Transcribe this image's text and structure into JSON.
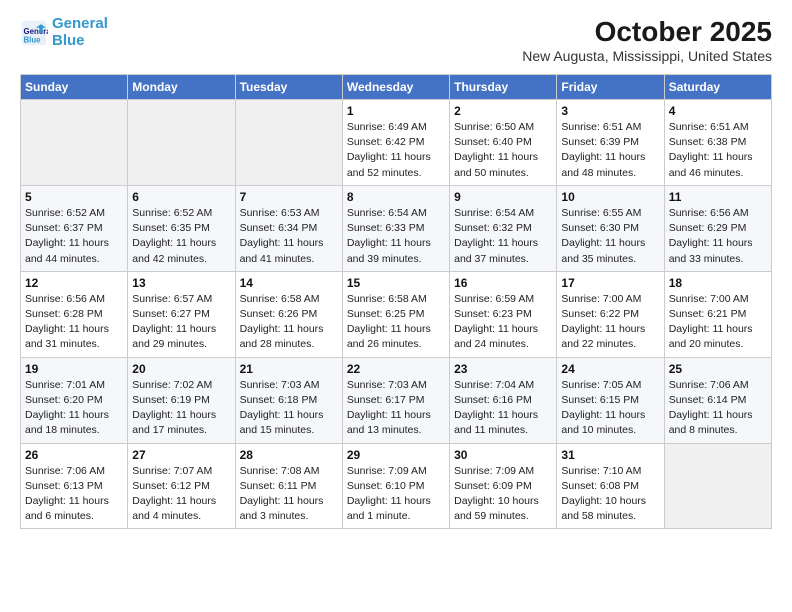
{
  "logo": {
    "line1": "General",
    "line2": "Blue"
  },
  "title": "October 2025",
  "subtitle": "New Augusta, Mississippi, United States",
  "days_header": [
    "Sunday",
    "Monday",
    "Tuesday",
    "Wednesday",
    "Thursday",
    "Friday",
    "Saturday"
  ],
  "weeks": [
    [
      {
        "num": "",
        "info": ""
      },
      {
        "num": "",
        "info": ""
      },
      {
        "num": "",
        "info": ""
      },
      {
        "num": "1",
        "info": "Sunrise: 6:49 AM\nSunset: 6:42 PM\nDaylight: 11 hours\nand 52 minutes."
      },
      {
        "num": "2",
        "info": "Sunrise: 6:50 AM\nSunset: 6:40 PM\nDaylight: 11 hours\nand 50 minutes."
      },
      {
        "num": "3",
        "info": "Sunrise: 6:51 AM\nSunset: 6:39 PM\nDaylight: 11 hours\nand 48 minutes."
      },
      {
        "num": "4",
        "info": "Sunrise: 6:51 AM\nSunset: 6:38 PM\nDaylight: 11 hours\nand 46 minutes."
      }
    ],
    [
      {
        "num": "5",
        "info": "Sunrise: 6:52 AM\nSunset: 6:37 PM\nDaylight: 11 hours\nand 44 minutes."
      },
      {
        "num": "6",
        "info": "Sunrise: 6:52 AM\nSunset: 6:35 PM\nDaylight: 11 hours\nand 42 minutes."
      },
      {
        "num": "7",
        "info": "Sunrise: 6:53 AM\nSunset: 6:34 PM\nDaylight: 11 hours\nand 41 minutes."
      },
      {
        "num": "8",
        "info": "Sunrise: 6:54 AM\nSunset: 6:33 PM\nDaylight: 11 hours\nand 39 minutes."
      },
      {
        "num": "9",
        "info": "Sunrise: 6:54 AM\nSunset: 6:32 PM\nDaylight: 11 hours\nand 37 minutes."
      },
      {
        "num": "10",
        "info": "Sunrise: 6:55 AM\nSunset: 6:30 PM\nDaylight: 11 hours\nand 35 minutes."
      },
      {
        "num": "11",
        "info": "Sunrise: 6:56 AM\nSunset: 6:29 PM\nDaylight: 11 hours\nand 33 minutes."
      }
    ],
    [
      {
        "num": "12",
        "info": "Sunrise: 6:56 AM\nSunset: 6:28 PM\nDaylight: 11 hours\nand 31 minutes."
      },
      {
        "num": "13",
        "info": "Sunrise: 6:57 AM\nSunset: 6:27 PM\nDaylight: 11 hours\nand 29 minutes."
      },
      {
        "num": "14",
        "info": "Sunrise: 6:58 AM\nSunset: 6:26 PM\nDaylight: 11 hours\nand 28 minutes."
      },
      {
        "num": "15",
        "info": "Sunrise: 6:58 AM\nSunset: 6:25 PM\nDaylight: 11 hours\nand 26 minutes."
      },
      {
        "num": "16",
        "info": "Sunrise: 6:59 AM\nSunset: 6:23 PM\nDaylight: 11 hours\nand 24 minutes."
      },
      {
        "num": "17",
        "info": "Sunrise: 7:00 AM\nSunset: 6:22 PM\nDaylight: 11 hours\nand 22 minutes."
      },
      {
        "num": "18",
        "info": "Sunrise: 7:00 AM\nSunset: 6:21 PM\nDaylight: 11 hours\nand 20 minutes."
      }
    ],
    [
      {
        "num": "19",
        "info": "Sunrise: 7:01 AM\nSunset: 6:20 PM\nDaylight: 11 hours\nand 18 minutes."
      },
      {
        "num": "20",
        "info": "Sunrise: 7:02 AM\nSunset: 6:19 PM\nDaylight: 11 hours\nand 17 minutes."
      },
      {
        "num": "21",
        "info": "Sunrise: 7:03 AM\nSunset: 6:18 PM\nDaylight: 11 hours\nand 15 minutes."
      },
      {
        "num": "22",
        "info": "Sunrise: 7:03 AM\nSunset: 6:17 PM\nDaylight: 11 hours\nand 13 minutes."
      },
      {
        "num": "23",
        "info": "Sunrise: 7:04 AM\nSunset: 6:16 PM\nDaylight: 11 hours\nand 11 minutes."
      },
      {
        "num": "24",
        "info": "Sunrise: 7:05 AM\nSunset: 6:15 PM\nDaylight: 11 hours\nand 10 minutes."
      },
      {
        "num": "25",
        "info": "Sunrise: 7:06 AM\nSunset: 6:14 PM\nDaylight: 11 hours\nand 8 minutes."
      }
    ],
    [
      {
        "num": "26",
        "info": "Sunrise: 7:06 AM\nSunset: 6:13 PM\nDaylight: 11 hours\nand 6 minutes."
      },
      {
        "num": "27",
        "info": "Sunrise: 7:07 AM\nSunset: 6:12 PM\nDaylight: 11 hours\nand 4 minutes."
      },
      {
        "num": "28",
        "info": "Sunrise: 7:08 AM\nSunset: 6:11 PM\nDaylight: 11 hours\nand 3 minutes."
      },
      {
        "num": "29",
        "info": "Sunrise: 7:09 AM\nSunset: 6:10 PM\nDaylight: 11 hours\nand 1 minute."
      },
      {
        "num": "30",
        "info": "Sunrise: 7:09 AM\nSunset: 6:09 PM\nDaylight: 10 hours\nand 59 minutes."
      },
      {
        "num": "31",
        "info": "Sunrise: 7:10 AM\nSunset: 6:08 PM\nDaylight: 10 hours\nand 58 minutes."
      },
      {
        "num": "",
        "info": ""
      }
    ]
  ]
}
